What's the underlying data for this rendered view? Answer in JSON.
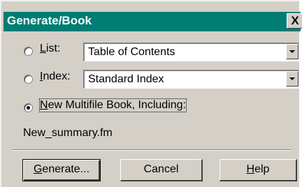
{
  "window": {
    "title": "Generate/Book",
    "close_glyph": "✕"
  },
  "options": [
    {
      "label_prefix": "",
      "mnemonic": "L",
      "label_suffix": "ist:",
      "selected": false,
      "select_value": "Table of Contents"
    },
    {
      "label_prefix": "",
      "mnemonic": "I",
      "label_suffix": "ndex:",
      "selected": false,
      "select_value": "Standard Index"
    },
    {
      "label_prefix": "",
      "mnemonic": "N",
      "label_suffix": "ew Multifile Book, Including:",
      "selected": true
    }
  ],
  "included_file": "New_summary.fm",
  "buttons": {
    "generate": {
      "mnemonic": "G",
      "rest": "enerate..."
    },
    "cancel": {
      "label": "Cancel"
    },
    "help": {
      "mnemonic": "H",
      "rest": "elp"
    }
  },
  "colors": {
    "titlebar": "#007d74",
    "face": "#d4d0c8"
  }
}
